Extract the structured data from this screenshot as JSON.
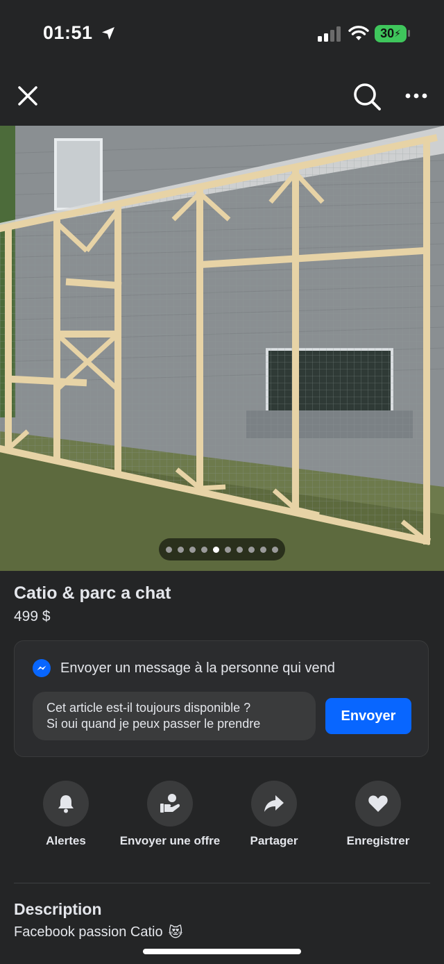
{
  "status_bar": {
    "time": "01:51",
    "battery": "30"
  },
  "icons": {
    "location": "location-arrow-icon",
    "signal": "cellular-signal-icon",
    "wifi": "wifi-icon",
    "battery": "battery-charging-icon",
    "close": "close-icon",
    "search": "search-icon",
    "more": "more-options-icon"
  },
  "photo": {
    "slide_count": 10,
    "active_index": 4
  },
  "listing": {
    "title": "Catio & parc a chat",
    "price": "499 $"
  },
  "message": {
    "heading": "Envoyer un message à la personne qui vend",
    "input_text": "Cet article est-il toujours disponible ?\nSi oui quand je peux passer le prendre",
    "send_label": "Envoyer"
  },
  "actions": [
    {
      "label": "Alertes",
      "icon": "bell-icon"
    },
    {
      "label": "Envoyer une offre",
      "icon": "offer-icon"
    },
    {
      "label": "Partager",
      "icon": "share-icon"
    },
    {
      "label": "Enregistrer",
      "icon": "heart-icon"
    }
  ],
  "description": {
    "heading": "Description",
    "text": "Facebook passion Catio",
    "emoji": "😻"
  },
  "colors": {
    "background": "#242526",
    "accent": "#0866ff",
    "battery": "#3fc65c"
  }
}
